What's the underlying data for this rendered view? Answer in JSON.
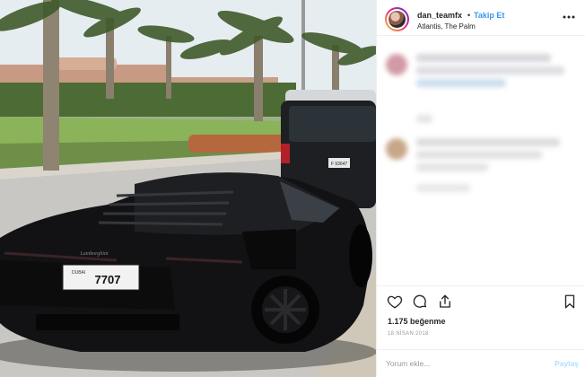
{
  "photo": {
    "plate_text": "7707",
    "plate_small": "DUBAI",
    "brand_badge": "Lamborghini",
    "rear_plate_text": "F 93647"
  },
  "post": {
    "username": "dan_teamfx",
    "separator": "•",
    "follow_label": "Takip Et",
    "location": "Atlantis, The Palm",
    "more_icon": "more-horizontal-icon"
  },
  "actions": {
    "icons": [
      "heart-icon",
      "comment-icon",
      "share-icon",
      "bookmark-icon"
    ],
    "likes": "1.175 beğenme",
    "date": "18 NİSAN 2018"
  },
  "comment_box": {
    "placeholder": "Yorum ekle...",
    "submit_label": "Paylaş"
  },
  "colors": {
    "link_blue": "#3897f0",
    "disabled_blue": "#b2dffc",
    "muted_gray": "#999999",
    "text": "#262626"
  }
}
